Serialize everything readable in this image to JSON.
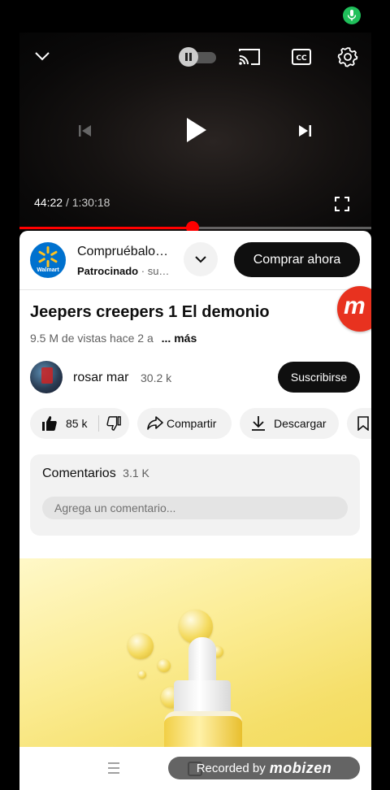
{
  "player": {
    "current_time": "44:22",
    "separator": "/",
    "duration": "1:30:18",
    "progress_fraction": 0.491
  },
  "ad": {
    "brand_logo_text": "Walmart",
    "title": "Compruébalo…",
    "sponsored_label": "Patrocinado",
    "sponsored_extra": "su…",
    "cta_label": "Comprar ahora"
  },
  "video": {
    "title": "Jeepers creepers 1 El demonio",
    "views": "9.5 M de vistas",
    "age": "hace 2 a",
    "more_label": "... más"
  },
  "channel": {
    "name": "rosar mar",
    "subscribers": "30.2 k",
    "subscribe_label": "Suscribirse"
  },
  "actions": {
    "likes": "85 k",
    "share_label": "Compartir",
    "download_label": "Descargar"
  },
  "comments": {
    "title": "Comentarios",
    "count": "3.1 K",
    "placeholder": "Agrega un comentario..."
  },
  "floating_logo_letter": "m",
  "recorder": {
    "prefix": "Recorded by",
    "brand": "mobizen"
  },
  "colors": {
    "accent_red": "#ff0000",
    "mic_green": "#1fbf5a",
    "walmart_blue": "#0071ce",
    "walmart_yellow": "#ffc220",
    "mobizen_red": "#e8321f"
  },
  "icons": [
    "mic-icon",
    "chevron-down-icon",
    "autoplay-toggle",
    "cast-icon",
    "captions-icon",
    "gear-icon",
    "previous-icon",
    "play-icon",
    "next-icon",
    "fullscreen-icon",
    "like-icon",
    "dislike-icon",
    "share-icon",
    "download-icon",
    "save-icon",
    "menu-icon",
    "home-icon"
  ]
}
